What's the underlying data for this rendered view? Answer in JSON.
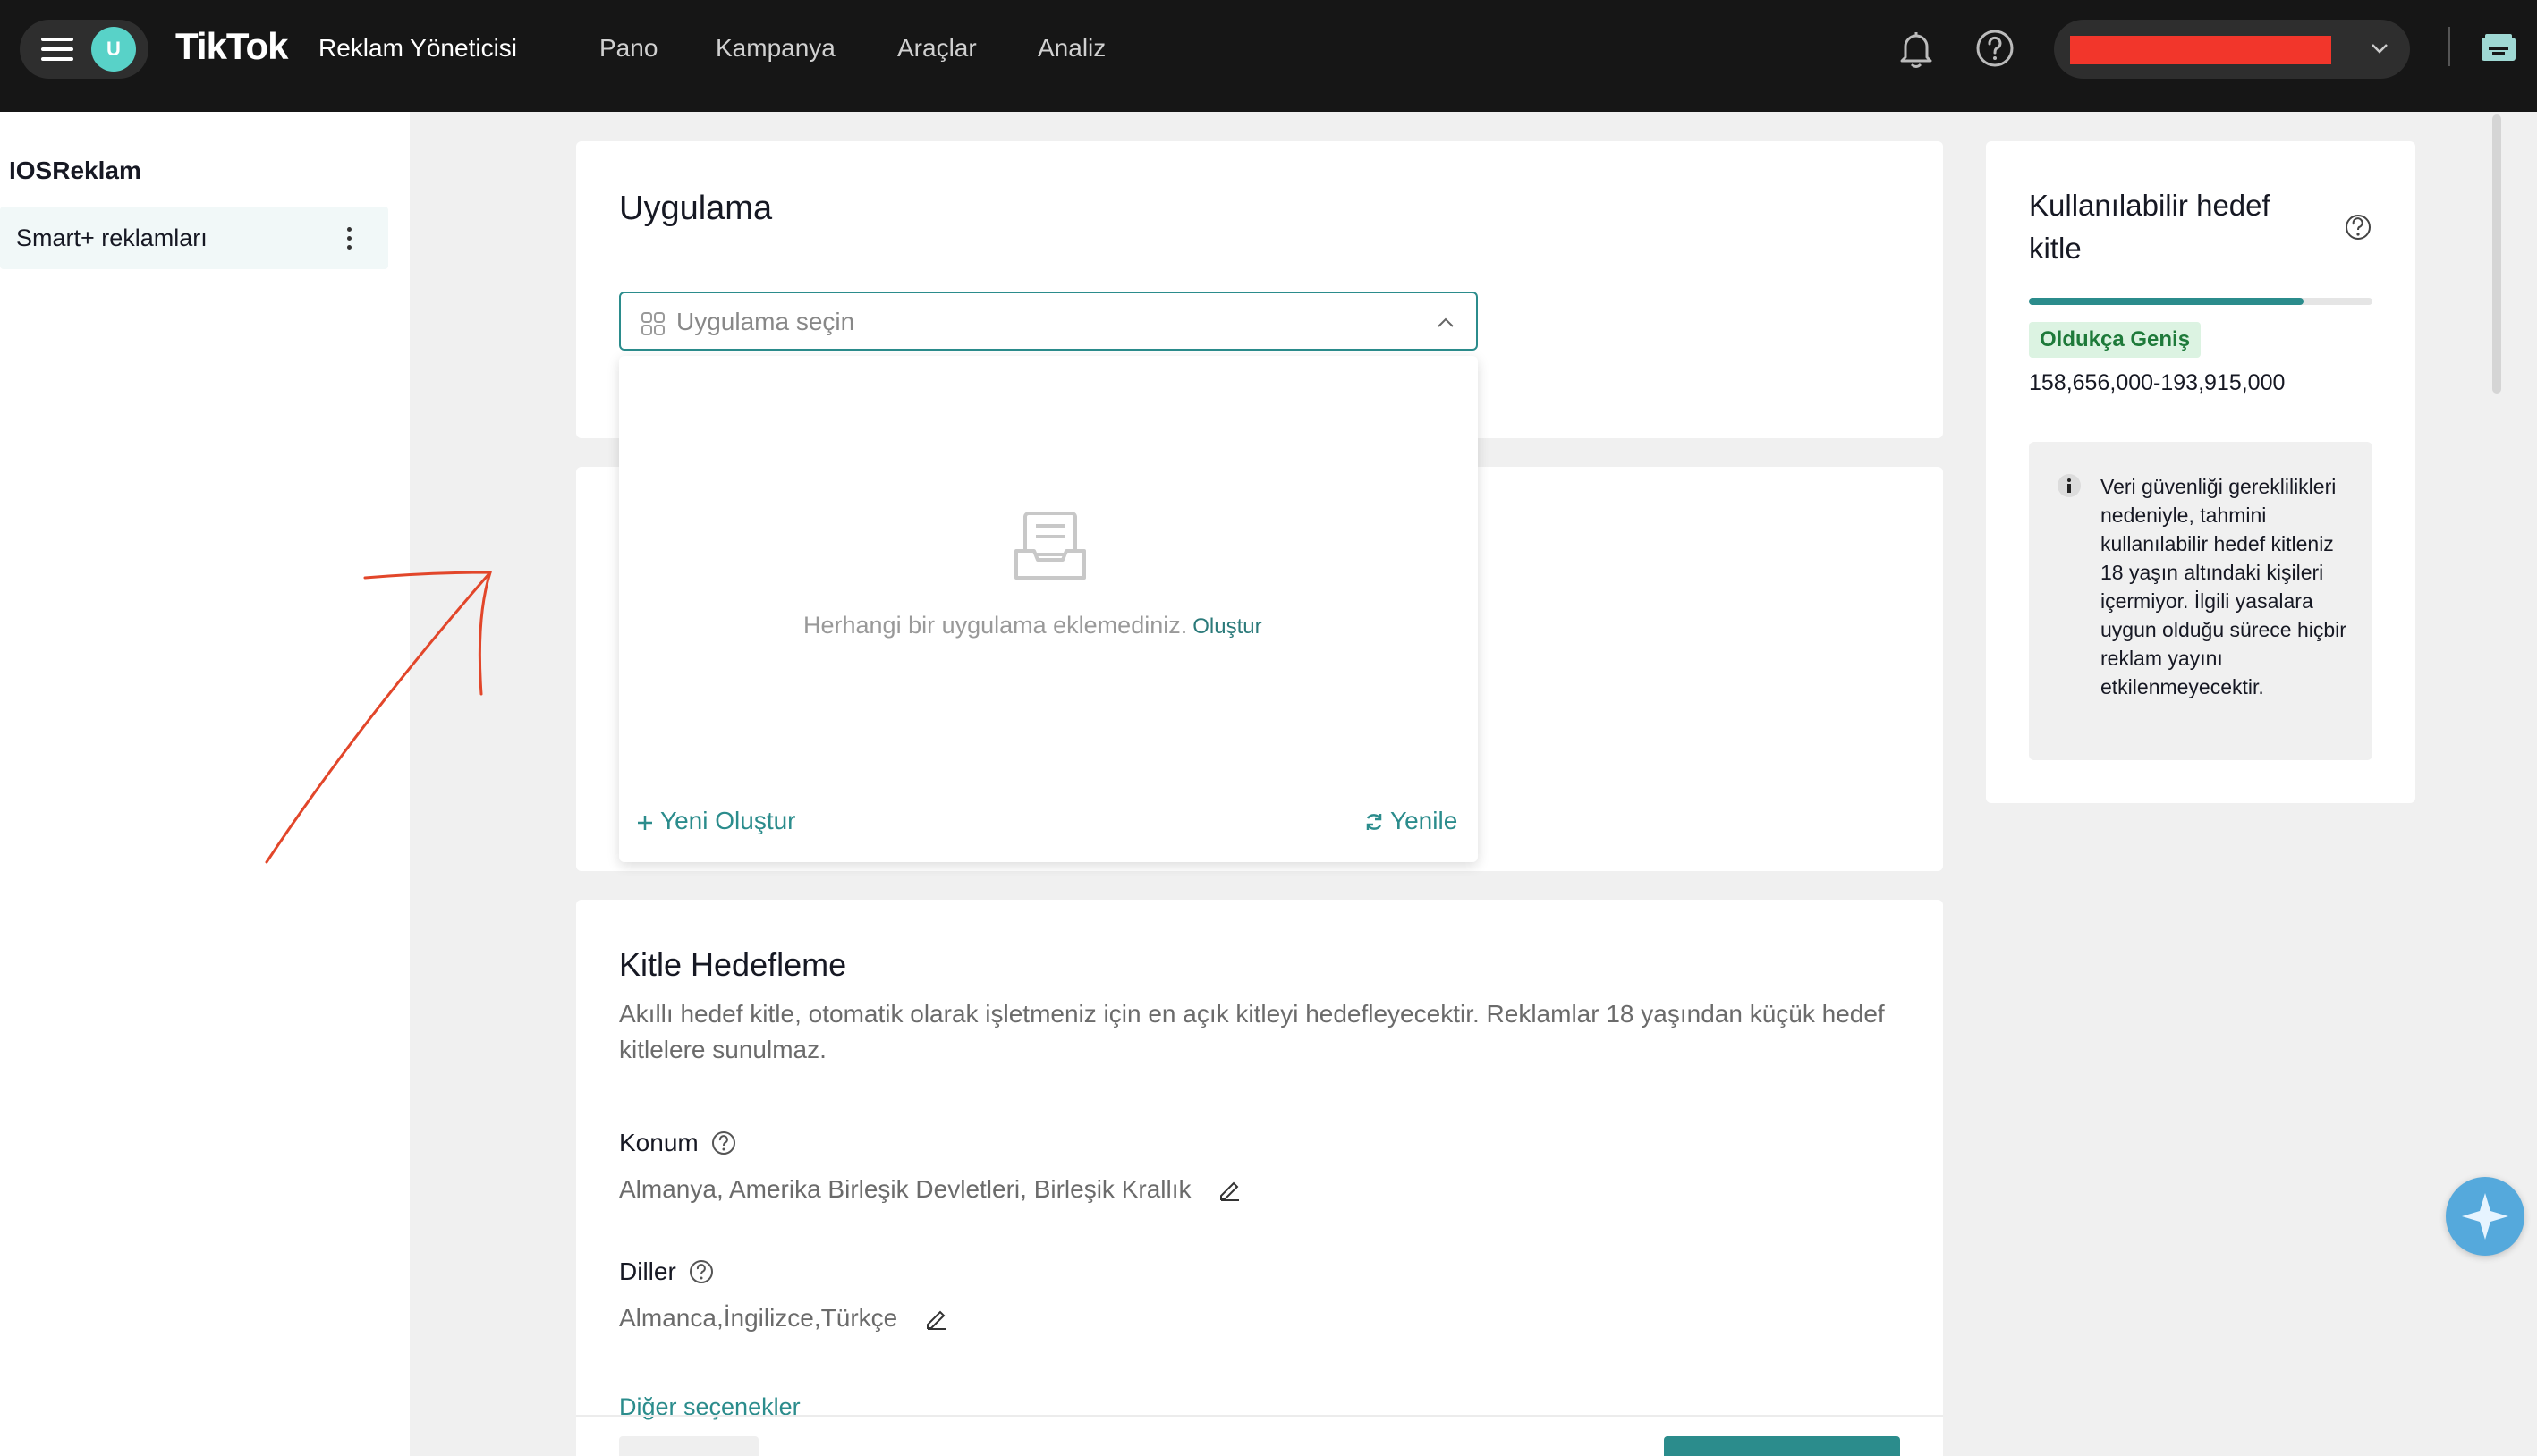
{
  "header": {
    "avatar_initial": "U",
    "brand": "TikTok",
    "brand_sub": "Reklam Yöneticisi",
    "nav": [
      "Pano",
      "Kampanya",
      "Araçlar",
      "Analiz"
    ]
  },
  "sidebar": {
    "title": "IOSReklam",
    "items": [
      {
        "label": "Smart+ reklamları"
      }
    ]
  },
  "app_section": {
    "title": "Uygulama",
    "select_placeholder": "Uygulama seçin",
    "empty_text": "Herhangi bir uygulama eklemediniz.",
    "empty_link": "Oluştur",
    "new_label": "Yeni Oluştur",
    "refresh_label": "Yenile"
  },
  "targeting": {
    "title": "Kitle Hedefleme",
    "description": "Akıllı hedef kitle, otomatik olarak işletmeniz için en açık kitleyi hedefleyecektir. Reklamlar 18 yaşından küçük hedef kitlelere sunulmaz.",
    "location_label": "Konum",
    "location_value": "Almanya, Amerika Birleşik Devletleri, Birleşik Krallık",
    "languages_label": "Diller",
    "languages_value": "Almanca,İngilizce,Türkçe",
    "more_options": "Diğer seçenekler"
  },
  "audience": {
    "title": "Kullanılabilir hedef kitle",
    "fill_fraction": 0.8,
    "badge": "Oldukça Geniş",
    "range": "158,656,000-193,915,000",
    "info": "Veri güvenliği gereklilikleri nedeniyle, tahmini kullanılabilir hedef kitleniz 18 yaşın altındaki kişileri içermiyor. İlgili yasalara uygun olduğu sürece hiçbir reklam yayını etkilenmeyecektir."
  },
  "colors": {
    "accent": "#2b8c8c",
    "topbar": "#161616",
    "redaction": "#f2362b",
    "annotation_arrow": "#e2462a"
  }
}
